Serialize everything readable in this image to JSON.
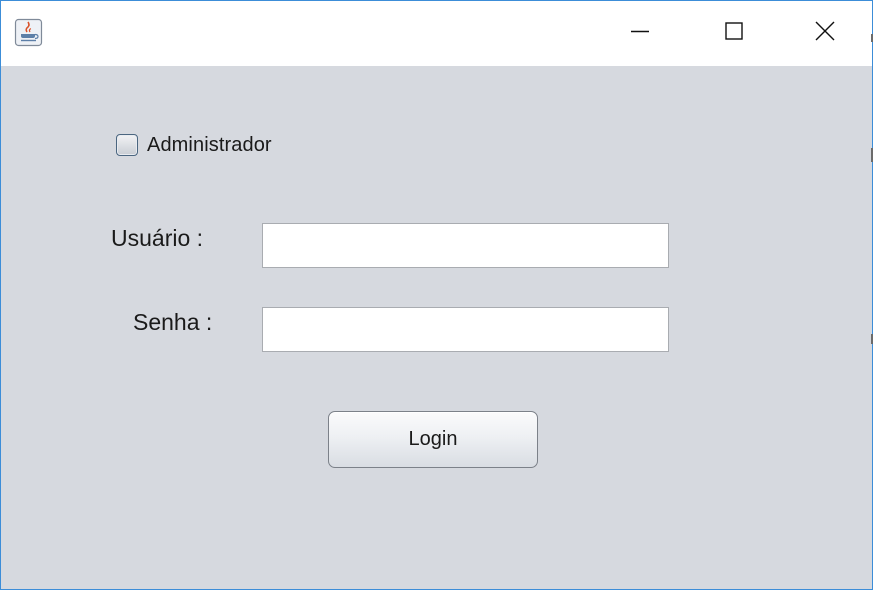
{
  "window": {
    "title": "",
    "icon": "java-cup-icon",
    "controls": {
      "minimize_icon": "minimize-icon",
      "maximize_icon": "maximize-icon",
      "close_icon": "close-icon"
    }
  },
  "form": {
    "admin_checkbox": {
      "label": "Administrador",
      "checked": false
    },
    "username": {
      "label": "Usuário :",
      "value": "",
      "placeholder": ""
    },
    "password": {
      "label": "Senha :",
      "value": "",
      "placeholder": ""
    },
    "login_button_label": "Login"
  },
  "colors": {
    "accent_border": "#3c8dd8",
    "client_background": "#d6d9df",
    "titlebar_background": "#ffffff"
  }
}
